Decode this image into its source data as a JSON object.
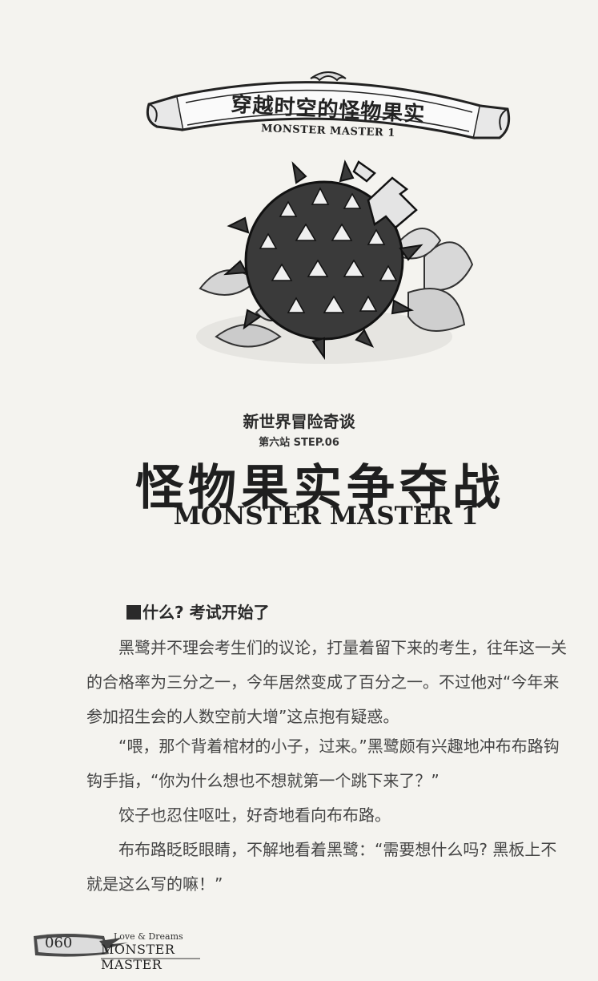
{
  "banner": {
    "title": "穿越时空的怪物果实",
    "subtitle": "MONSTER MASTER 1"
  },
  "chapter": {
    "series": "新世界冒险奇谈",
    "step": "第六站 STEP.06",
    "title": "怪物果实争夺战",
    "subtitle": "MONSTER MASTER 1"
  },
  "section": {
    "heading": "什么? 考试开始了"
  },
  "paragraphs": [
    "黑鹭并不理会考生们的议论，打量着留下来的考生，往年这一关的合格率为三分之一，今年居然变成了百分之一。不过他对“今年来参加招生会的人数空前大增”这点抱有疑惑。",
    "“喂，那个背着棺材的小子，过来。”黑鹭颇有兴趣地冲布布路钩钩手指，“你为什么想也不想就第一个跳下来了？”",
    "饺子也忍住呕吐，好奇地看向布布路。",
    "布布路眨眨眼睛，不解地看着黑鹭：“需要想什么吗? 黑板上不就是这么写的嘛！”"
  ],
  "footer": {
    "page_number": "060",
    "tagline": "Love & Dreams",
    "brand": "MONSTER MASTER"
  }
}
